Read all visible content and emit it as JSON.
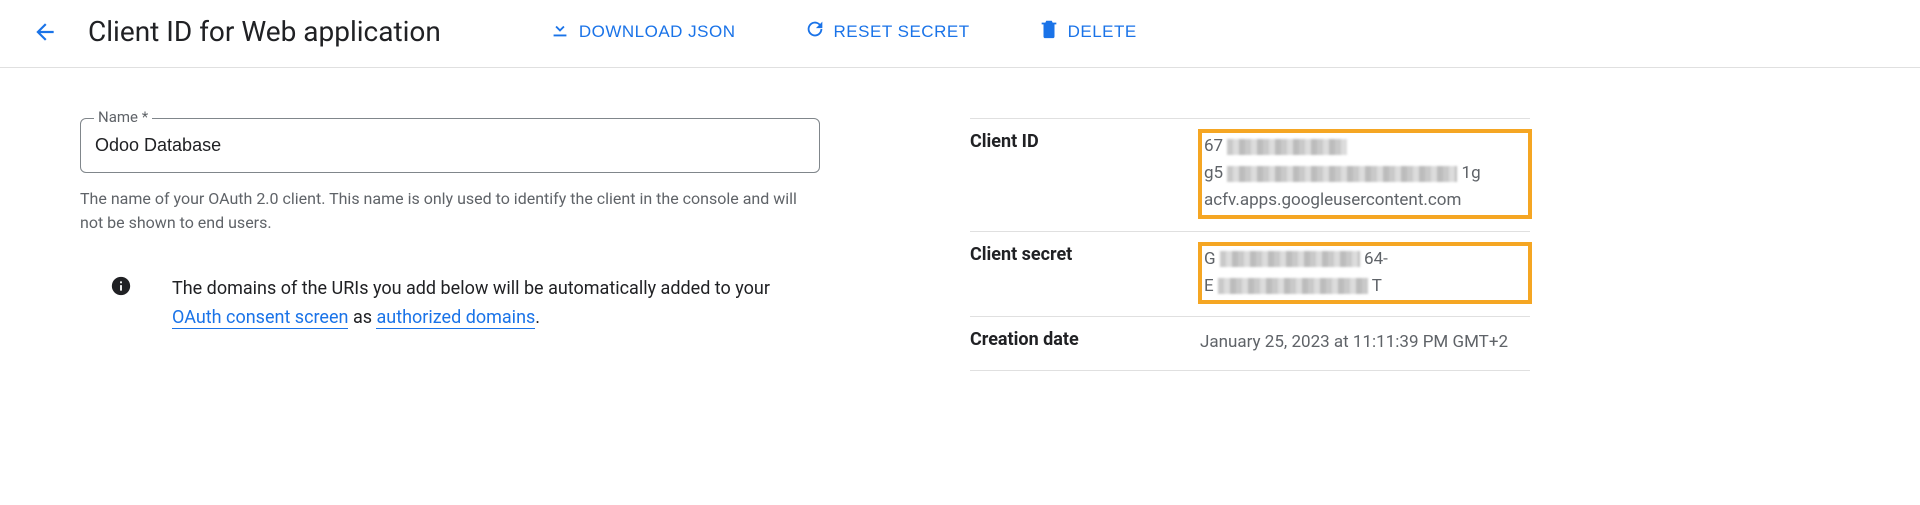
{
  "header": {
    "title": "Client ID for Web application",
    "download_label": "DOWNLOAD JSON",
    "reset_label": "RESET SECRET",
    "delete_label": "DELETE"
  },
  "name_field": {
    "label": "Name *",
    "value": "Odoo Database",
    "help": "The name of your OAuth 2.0 client. This name is only used to identify the client in the console and will not be shown to end users."
  },
  "info": {
    "text_before": "The domains of the URIs you add below will be automatically added to your ",
    "link1": "OAuth consent screen",
    "text_mid": " as ",
    "link2": "authorized domains",
    "text_after": "."
  },
  "details": {
    "client_id": {
      "label": "Client ID",
      "line1_prefix": "67",
      "line2_prefix": "g5",
      "line2_suffix": "1g",
      "line3": "acfv.apps.googleusercontent.com"
    },
    "client_secret": {
      "label": "Client secret",
      "line1_prefix": "G",
      "line1_suffix": "64-",
      "line2_prefix": "E",
      "line2_suffix": "T"
    },
    "creation_date": {
      "label": "Creation date",
      "value": "January 25, 2023 at 11:11:39 PM GMT+2"
    }
  }
}
